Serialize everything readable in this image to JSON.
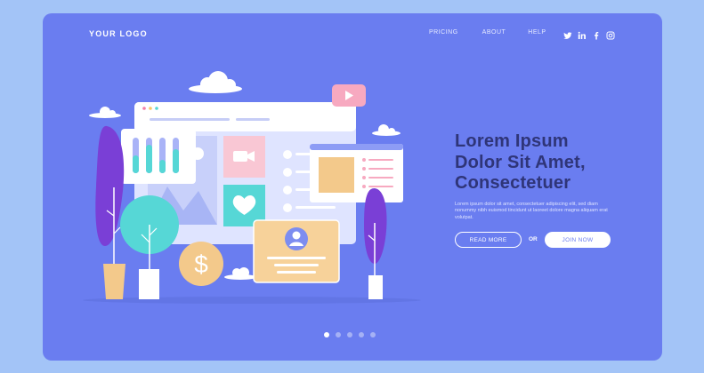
{
  "header": {
    "logo": "YOUR LOGO",
    "nav": [
      "PRICING",
      "ABOUT",
      "HELP"
    ],
    "social_icons": [
      "twitter-icon",
      "linkedin-icon",
      "facebook-icon",
      "instagram-icon"
    ]
  },
  "hero": {
    "title_line1": "Lorem Ipsum",
    "title_line2": "Dolor Sit Amet,",
    "title_line3": "Consectetuer",
    "body": "Lorem ipsum dolor sit amet, consectetuer adipiscing elit, sed diam nonummy nibh euismod tincidunt ut laoreet dolore magna aliquam erat volutpat.",
    "read_more": "READ MORE",
    "or": "OR",
    "join_now": "JOIN NOW"
  },
  "carousel": {
    "count": 5,
    "active_index": 0
  },
  "colors": {
    "page_bg": "#a3c4f7",
    "card_bg": "#6a7df0",
    "title": "#2f3578",
    "accent_pink": "#f7a9c0",
    "accent_teal": "#56d7d6",
    "accent_gold": "#f3c98b",
    "accent_purple": "#7a3fd6"
  }
}
